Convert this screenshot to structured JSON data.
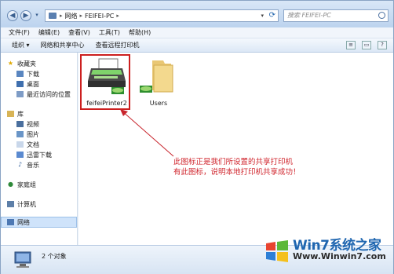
{
  "address": {
    "crumbs": [
      "网络",
      "FEIFEI-PC"
    ]
  },
  "search": {
    "placeholder": "搜索 FEIFEI-PC"
  },
  "menubar": {
    "items": [
      "文件(F)",
      "编辑(E)",
      "查看(V)",
      "工具(T)",
      "帮助(H)"
    ]
  },
  "toolbar": {
    "items": [
      "组织 ▾",
      "网络和共享中心",
      "查看远程打印机"
    ]
  },
  "sidebar": {
    "favorites_label": "收藏夹",
    "favorites": [
      "下载",
      "桌面",
      "最近访问的位置"
    ],
    "library_label": "库",
    "libraries": [
      "视频",
      "图片",
      "文档",
      "迅雷下载",
      "音乐"
    ],
    "homegroup": "家庭组",
    "computer": "计算机",
    "network": "网络"
  },
  "items": [
    {
      "name": "feifeiPrinter2",
      "icon": "printer-icon"
    },
    {
      "name": "Users",
      "icon": "shared-folder-icon"
    }
  ],
  "annotation": {
    "line1": "此图标正是我们所设置的共享打印机",
    "line2": "有此图标，说明本地打印机共享成功！"
  },
  "status": {
    "count_text": "2 个对象"
  },
  "watermark": {
    "brand": "Win7系统之家",
    "url": "Www.Winwin7.com"
  },
  "colors": {
    "accent": "#1f66b0",
    "annotation": "#d0252d"
  }
}
